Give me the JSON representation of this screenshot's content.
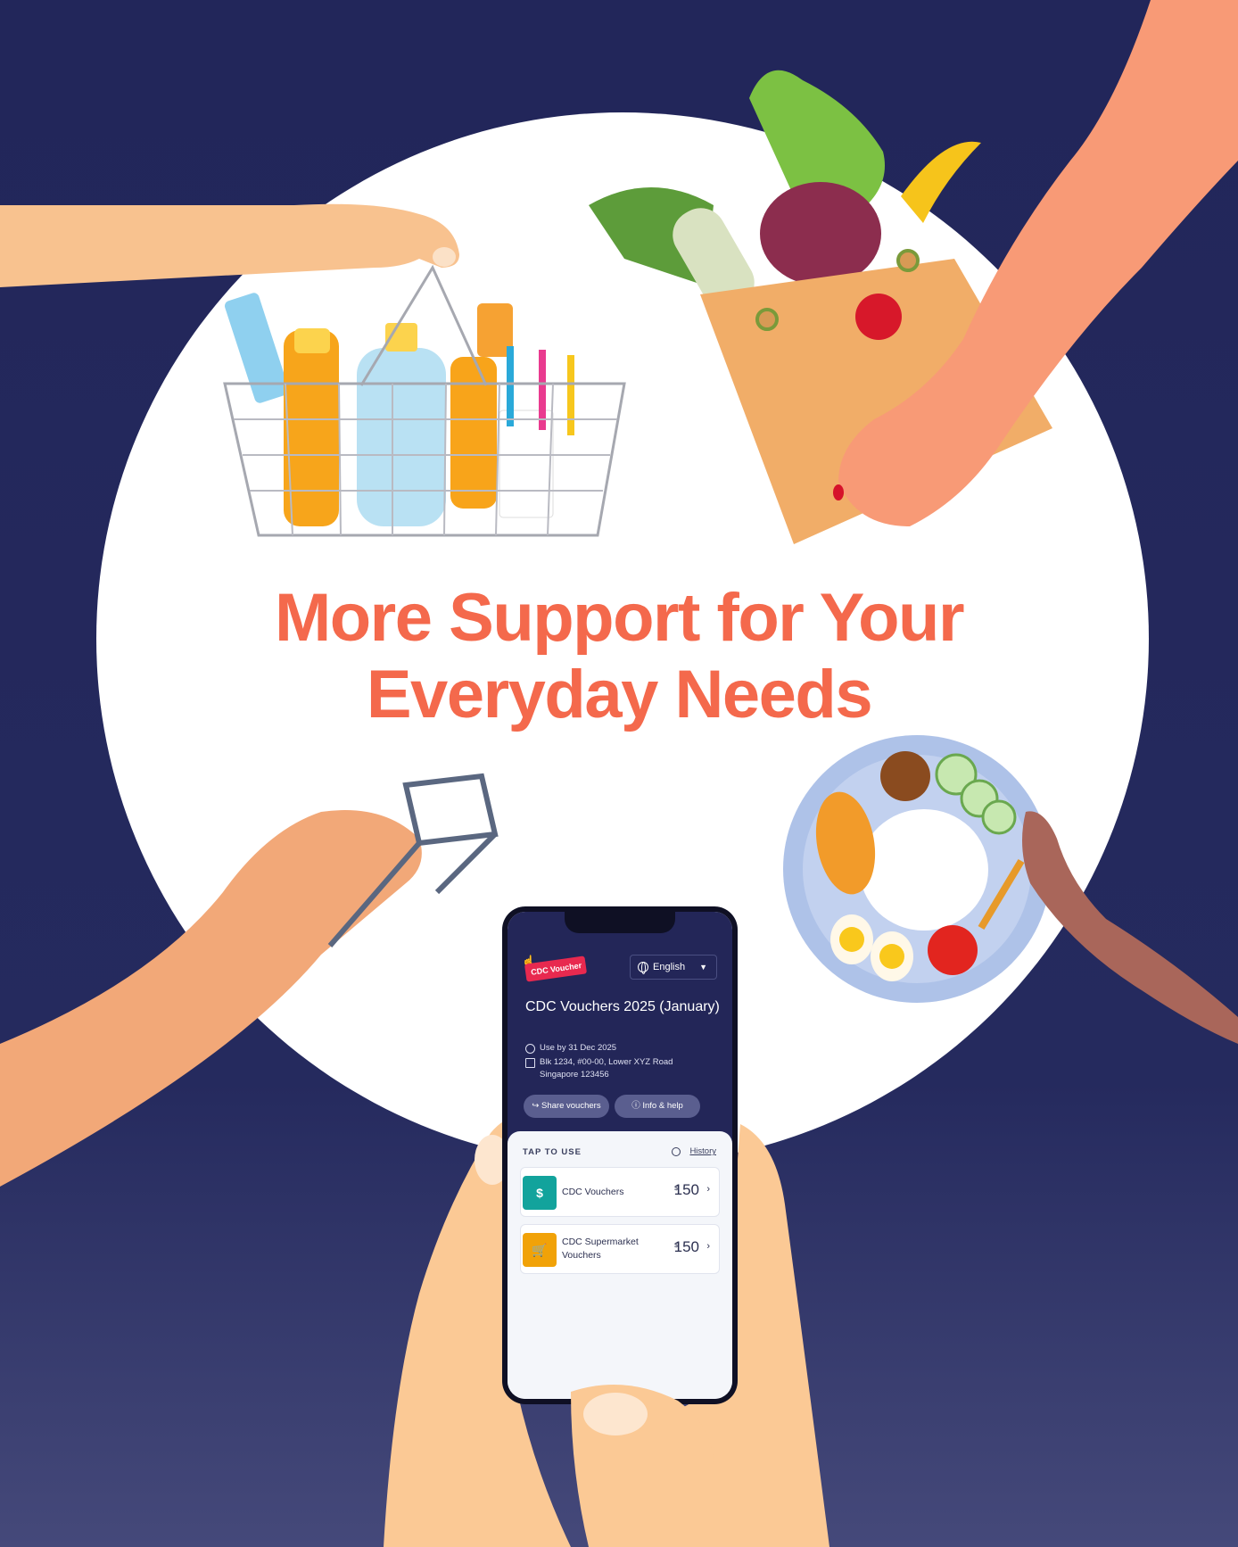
{
  "headline": {
    "line1": "More Support for Your",
    "line2": "Everyday Needs"
  },
  "colors": {
    "background": "#22265a",
    "headline": "#f4694c",
    "circle": "#ffffff",
    "phone_header": "#232658",
    "brand_red": "#e8294f",
    "cdc_vouchers_icon": "#12a39c",
    "supermarket_icon": "#f1a208"
  },
  "phone": {
    "logo_text": "CDC Voucher",
    "language": "English",
    "title": "CDC Vouchers 2025 (January)",
    "use_by": "Use by 31 Dec 2025",
    "address_line1": "Blk 1234, #00-00, Lower XYZ Road",
    "address_line2": "Singapore 123456",
    "share_button": "Share vouchers",
    "info_button": "Info & help",
    "tap_to_use": "TAP TO USE",
    "history": "History",
    "vouchers": [
      {
        "label": "CDC Vouchers",
        "currency": "$",
        "amount": "150",
        "icon": "voucher-ticket-icon"
      },
      {
        "label": "CDC Supermarket Vouchers",
        "currency": "$",
        "amount": "150",
        "icon": "shopping-cart-icon"
      }
    ]
  },
  "illustrations": [
    "hand-with-basket",
    "toiletries-basket",
    "grocery-bag-with-produce",
    "hand-holding-glasses",
    "plate-of-nasi-lemak",
    "hands-holding-phone"
  ]
}
